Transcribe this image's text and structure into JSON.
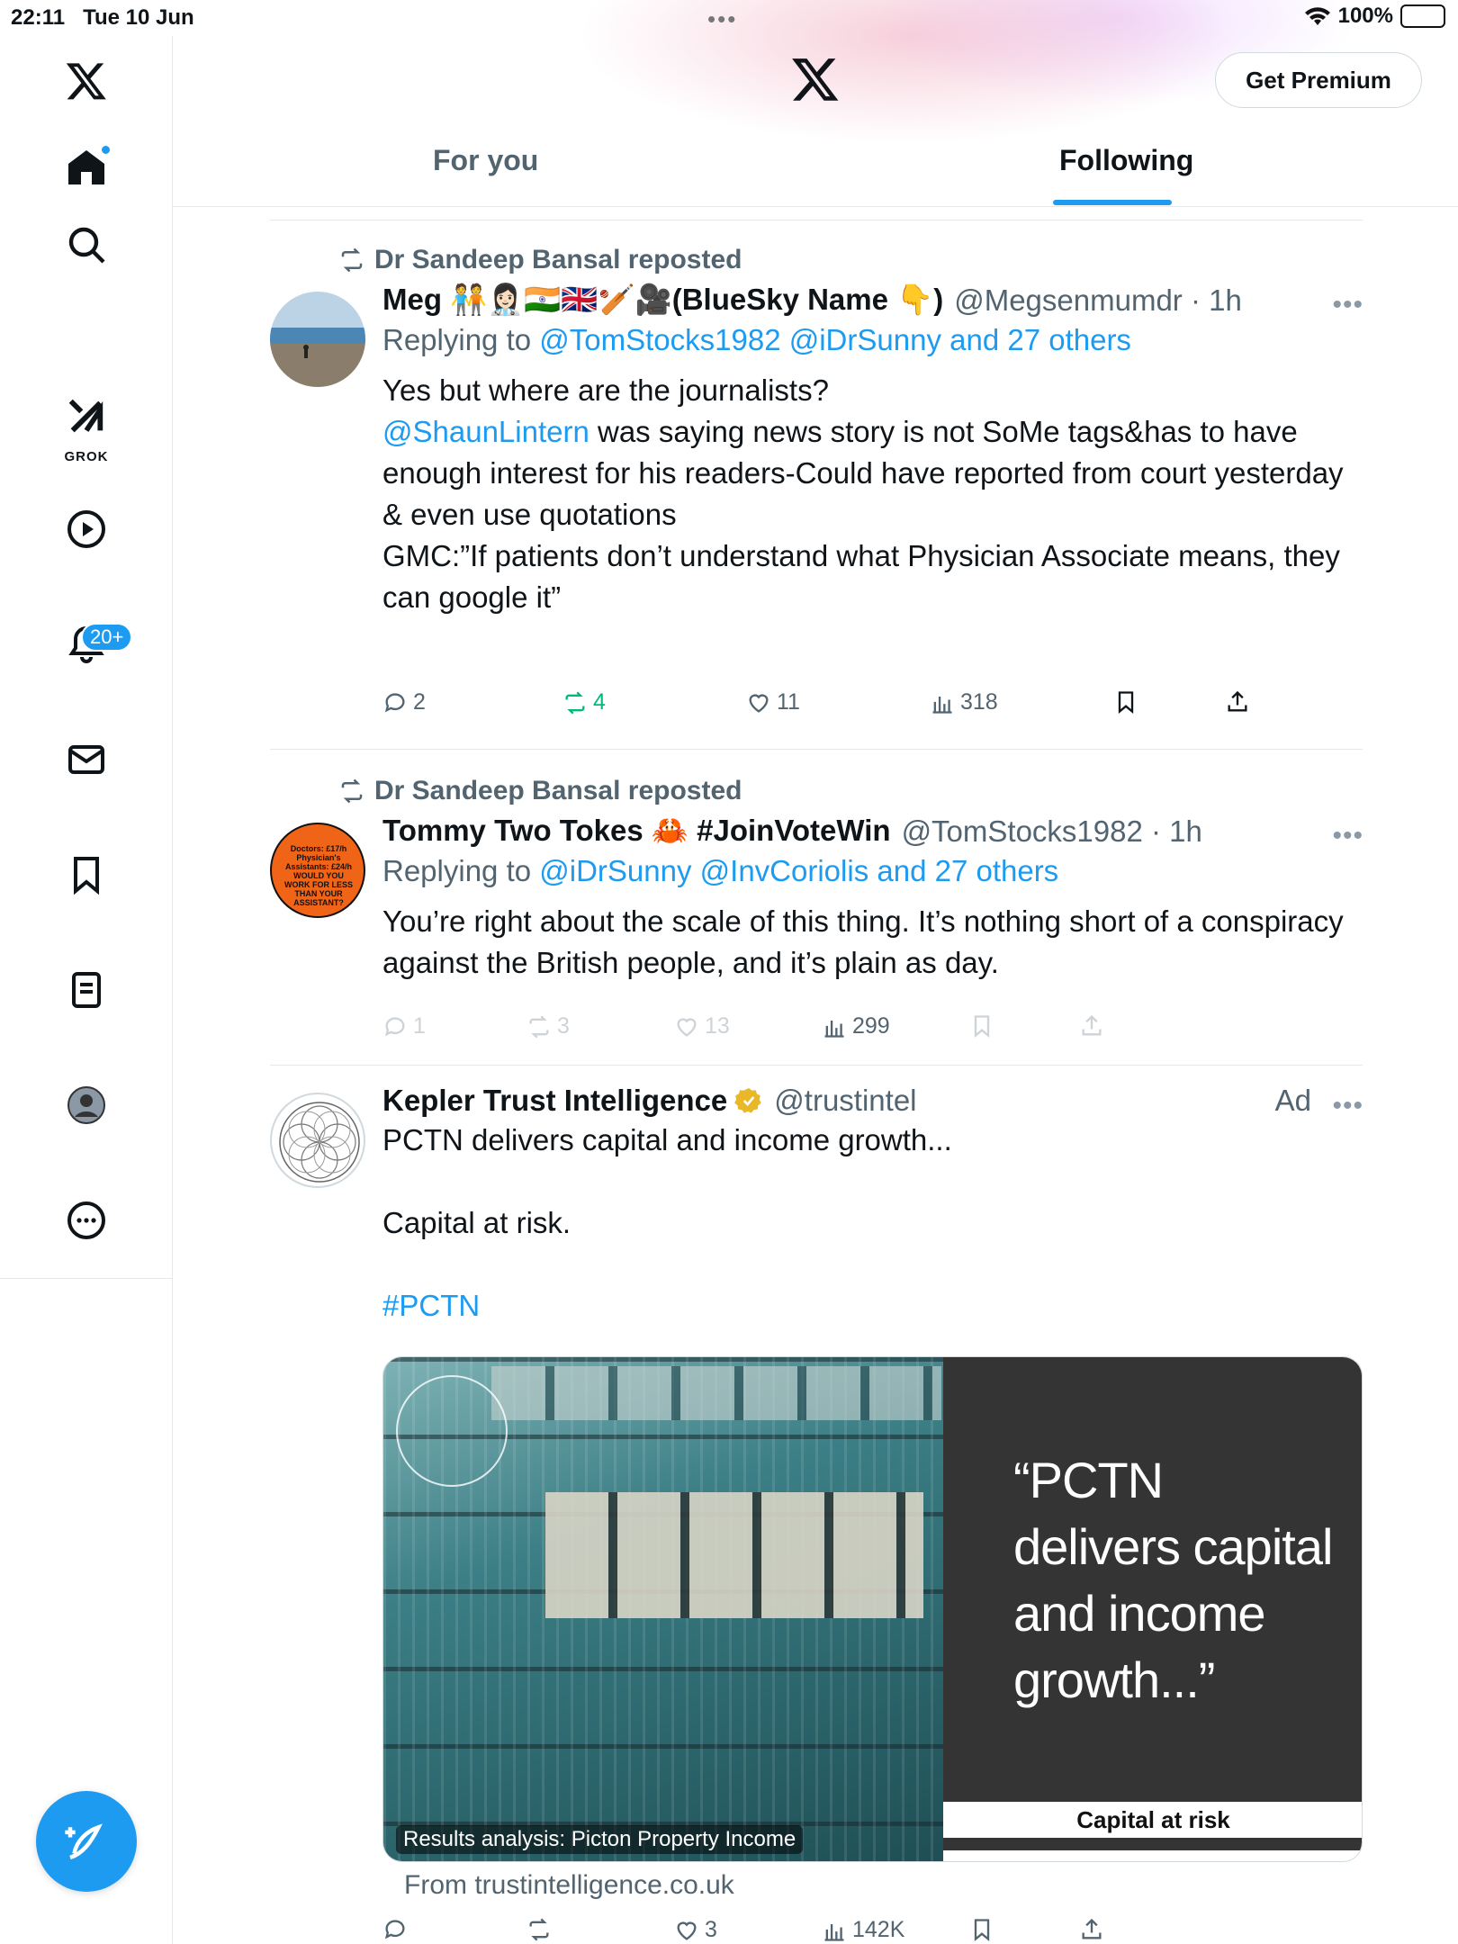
{
  "status_bar": {
    "time": "22:11",
    "date": "Tue 10 Jun",
    "battery": "100%"
  },
  "sidebar": {
    "items": [
      {
        "label": "Home",
        "icon": "home-icon"
      },
      {
        "label": "Search",
        "icon": "search-icon"
      },
      {
        "label": "GROK",
        "icon": "grok-icon"
      },
      {
        "label": "Video",
        "icon": "play-icon"
      },
      {
        "label": "Notifications",
        "icon": "bell-icon",
        "badge": "20+"
      },
      {
        "label": "Messages",
        "icon": "mail-icon"
      },
      {
        "label": "Bookmarks",
        "icon": "bookmark-icon"
      },
      {
        "label": "Lists",
        "icon": "list-icon"
      },
      {
        "label": "Profile",
        "icon": "profile-icon"
      },
      {
        "label": "More",
        "icon": "more-icon"
      }
    ]
  },
  "header": {
    "premium_label": "Get Premium",
    "tabs": [
      "For you",
      "Following"
    ],
    "active_tab": "Following"
  },
  "posts": [
    {
      "repost_by": "Dr Sandeep Bansal reposted",
      "name": "Meg 🧑‍🤝‍🧑👩🏻‍⚕️🇮🇳🇬🇧🏏🎥(BlueSky Name 👇)",
      "handle": "@Megsenmumdr · 1h",
      "replying_prefix": "Replying to ",
      "replying_to": "@TomStocks1982 @iDrSunny and 27 others",
      "lines": [
        "Yes but where are the journalists?",
        "was saying news story is not SoMe tags&has to have enough interest for his readers-Could have reported from court yesterday",
        "& even use quotations",
        "GMC:”If patients don’t understand what Physician Associate means, they can google it”"
      ],
      "mention": "@ShaunLintern",
      "replies": "2",
      "reposts": "4",
      "likes": "11",
      "views": "318"
    },
    {
      "repost_by": "Dr Sandeep Bansal reposted",
      "name": "Tommy Two Tokes 🦀 #JoinVoteWin",
      "handle": "@TomStocks1982 · 1h",
      "replying_prefix": "Replying to ",
      "replying_to": "@iDrSunny @InvCoriolis and 27 others",
      "text": "You’re right about the scale of this thing. It’s nothing short of a conspiracy against the British people, and it’s plain as day.",
      "avatar_text": "Doctors: £17/h Physician's Assistants: £24/h WOULD YOU WORK FOR LESS THAN YOUR ASSISTANT?",
      "replies": "1",
      "reposts": "3",
      "likes": "13",
      "views": "299"
    },
    {
      "name": "Kepler Trust Intelligence",
      "handle": "@trustintel",
      "ad_label": "Ad",
      "line1": "PCTN delivers capital and income growth...",
      "line2": "Capital at risk.",
      "hashtag": "#PCTN",
      "media_caption": "Results analysis: Picton Property Income",
      "media_quote": "“PCTN delivers capital and income growth...”",
      "media_footer": "Capital at risk",
      "from": "From trustintelligence.co.uk",
      "likes": "3",
      "views": "142K"
    }
  ],
  "colors": {
    "accent": "#1d9bf0",
    "repost_green": "#00ba7c",
    "muted": "#536471"
  }
}
